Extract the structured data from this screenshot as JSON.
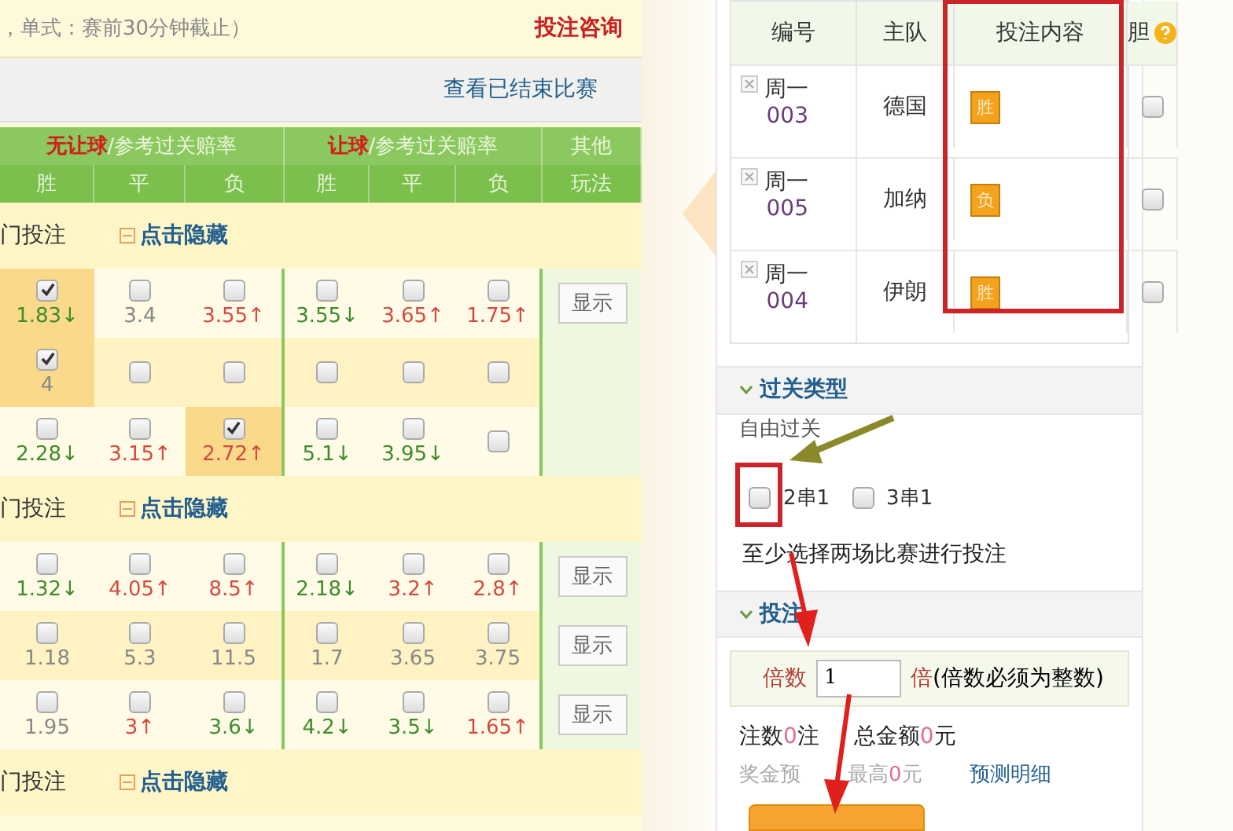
{
  "notice": {
    "text": "，单式：赛前30分钟截止）",
    "link": "投注咨询"
  },
  "finished_link": "查看已结束比赛",
  "header_groups": [
    {
      "kind": "odds",
      "highlight": "无让球",
      "rest": "/参考过关赔率"
    },
    {
      "kind": "odds",
      "highlight": "让球",
      "rest": "/参考过关赔率"
    },
    {
      "kind": "other",
      "rest": "其他"
    }
  ],
  "header_columns": [
    "胜",
    "平",
    "负",
    "胜",
    "平",
    "负",
    "玩法"
  ],
  "groups": [
    {
      "title": "门投注",
      "toggle": "点击隐藏",
      "matches": [
        {
          "button": "显示",
          "cells": [
            {
              "odds": "1.83↓",
              "color": "#3c8c2c",
              "checked": true
            },
            {
              "odds": "3.4",
              "color": "#888888",
              "checked": false
            },
            {
              "odds": "3.55↑",
              "color": "#d24a42",
              "checked": false
            },
            {
              "odds": "3.55↓",
              "color": "#3c8c2c",
              "checked": false
            },
            {
              "odds": "3.65↑",
              "color": "#d24a42",
              "checked": false
            },
            {
              "odds": "1.75↑",
              "color": "#d24a42",
              "checked": false
            }
          ]
        },
        {
          "cells": [
            {
              "odds": "4",
              "color": "#888888",
              "checked": true
            },
            {
              "checked": false
            },
            {
              "checked": false
            },
            {
              "checked": false
            },
            {
              "checked": false
            },
            {
              "checked": false
            }
          ]
        },
        {
          "cells": [
            {
              "odds": "2.28↓",
              "color": "#3c8c2c",
              "checked": false
            },
            {
              "odds": "3.15↑",
              "color": "#d24a42",
              "checked": false
            },
            {
              "odds": "2.72↑",
              "color": "#d24a42",
              "checked": true
            },
            {
              "odds": "5.1↓",
              "color": "#3c8c2c",
              "checked": false
            },
            {
              "odds": "3.95↓",
              "color": "#3c8c2c",
              "checked": false
            },
            {
              "checked": false
            }
          ]
        }
      ]
    },
    {
      "title": "门投注",
      "toggle": "点击隐藏",
      "matches": [
        {
          "button": "显示",
          "cells": [
            {
              "odds": "1.32↓",
              "color": "#3c8c2c",
              "checked": false
            },
            {
              "odds": "4.05↑",
              "color": "#d24a42",
              "checked": false
            },
            {
              "odds": "8.5↑",
              "color": "#d24a42",
              "checked": false
            },
            {
              "odds": "2.18↓",
              "color": "#3c8c2c",
              "checked": false
            },
            {
              "odds": "3.2↑",
              "color": "#d24a42",
              "checked": false
            },
            {
              "odds": "2.8↑",
              "color": "#d24a42",
              "checked": false
            }
          ]
        },
        {
          "button": "显示",
          "cells": [
            {
              "odds": "1.18",
              "color": "#888888",
              "checked": false
            },
            {
              "odds": "5.3",
              "color": "#888888",
              "checked": false
            },
            {
              "odds": "11.5",
              "color": "#888888",
              "checked": false
            },
            {
              "odds": "1.7",
              "color": "#888888",
              "checked": false
            },
            {
              "odds": "3.65",
              "color": "#888888",
              "checked": false
            },
            {
              "odds": "3.75",
              "color": "#888888",
              "checked": false
            }
          ]
        },
        {
          "button": "显示",
          "cells": [
            {
              "odds": "1.95",
              "color": "#888888",
              "checked": false
            },
            {
              "odds": "3↑",
              "color": "#d24a42",
              "checked": false
            },
            {
              "odds": "3.6↓",
              "color": "#3c8c2c",
              "checked": false
            },
            {
              "odds": "4.2↓",
              "color": "#3c8c2c",
              "checked": false
            },
            {
              "odds": "3.5↓",
              "color": "#3c8c2c",
              "checked": false
            },
            {
              "odds": "1.65↑",
              "color": "#d24a42",
              "checked": false
            }
          ]
        }
      ]
    },
    {
      "title": "门投注",
      "toggle": "点击隐藏"
    }
  ],
  "slip": {
    "columns": [
      "编号",
      "主队",
      "投注内容",
      "胆"
    ],
    "rows": [
      {
        "day": "周一",
        "number": "003",
        "team": "德国",
        "pick": "胜",
        "banker": false
      },
      {
        "day": "周一",
        "number": "005",
        "team": "加纳",
        "pick": "负",
        "banker": false
      },
      {
        "day": "周一",
        "number": "004",
        "team": "伊朗",
        "pick": "胜",
        "banker": false
      }
    ]
  },
  "parlay": {
    "title": "过关类型",
    "mode": "自由过关",
    "options": [
      {
        "label": "2串1",
        "checked": false
      },
      {
        "label": "3串1",
        "checked": false
      }
    ],
    "hint": "至少选择两场比赛进行投注"
  },
  "bet": {
    "title": "投注",
    "multiplier_label": "倍数",
    "multiplier_value": "1",
    "multiplier_unit": "倍",
    "multiplier_note": "(倍数必须为整数)",
    "count_label": "注数",
    "count": "0",
    "count_unit": "注",
    "total_label": "总金额",
    "total": "0",
    "total_unit": "元",
    "prize_label": "奖金预",
    "max_label": "最高",
    "max": "0",
    "max_unit": "元",
    "detail_link": "预测明细"
  }
}
